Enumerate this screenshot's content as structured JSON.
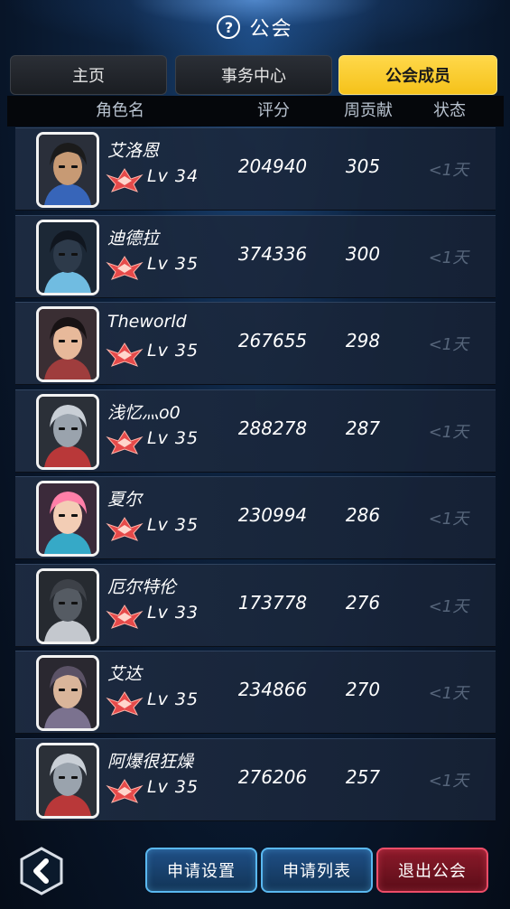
{
  "header": {
    "help_icon": "?",
    "title": "公会"
  },
  "tabs": [
    {
      "label": "主页",
      "active": false
    },
    {
      "label": "事务中心",
      "active": false
    },
    {
      "label": "公会成员",
      "active": true
    }
  ],
  "columns": {
    "name": "角色名",
    "score": "评分",
    "weekly": "周贡献",
    "status": "状态"
  },
  "members": [
    {
      "name": "艾洛恩",
      "level": "Lv 34",
      "score": "204940",
      "weekly": "305",
      "status": "<1天",
      "avatar_colors": {
        "bg": "#2a2f3a",
        "hair": "#1b1b1b",
        "skin": "#c79a74",
        "accent": "#3a6fd0"
      }
    },
    {
      "name": "迪德拉",
      "level": "Lv 35",
      "score": "374336",
      "weekly": "300",
      "status": "<1天",
      "avatar_colors": {
        "bg": "#1c2836",
        "hair": "#10161f",
        "skin": "#2d3a4a",
        "accent": "#7fd6ff"
      }
    },
    {
      "name": "Theworld",
      "level": "Lv 35",
      "score": "267655",
      "weekly": "298",
      "status": "<1天",
      "avatar_colors": {
        "bg": "#3a2e33",
        "hair": "#171214",
        "skin": "#e7b99a",
        "accent": "#b24040"
      }
    },
    {
      "name": "浅忆灬o0",
      "level": "Lv 35",
      "score": "288278",
      "weekly": "287",
      "status": "<1天",
      "avatar_colors": {
        "bg": "#2b3038",
        "hair": "#c9cfd6",
        "skin": "#9aa3ad",
        "accent": "#d23a3a"
      }
    },
    {
      "name": "夏尔",
      "level": "Lv 35",
      "score": "230994",
      "weekly": "286",
      "status": "<1天",
      "avatar_colors": {
        "bg": "#3b2a3a",
        "hair": "#ff7fa8",
        "skin": "#f3cdb5",
        "accent": "#36c0e0"
      }
    },
    {
      "name": "厄尔特伦",
      "level": "Lv 33",
      "score": "173778",
      "weekly": "276",
      "status": "<1天",
      "avatar_colors": {
        "bg": "#262a30",
        "hair": "#3d4148",
        "skin": "#555b63",
        "accent": "#e0e4ea"
      }
    },
    {
      "name": "艾达",
      "level": "Lv 35",
      "score": "234866",
      "weekly": "270",
      "status": "<1天",
      "avatar_colors": {
        "bg": "#2a2830",
        "hair": "#5b5266",
        "skin": "#d9b59a",
        "accent": "#8a7fa0"
      }
    },
    {
      "name": "阿爆很狂燥",
      "level": "Lv 35",
      "score": "276206",
      "weekly": "257",
      "status": "<1天",
      "avatar_colors": {
        "bg": "#2b3038",
        "hair": "#c9cfd6",
        "skin": "#9aa3ad",
        "accent": "#d23a3a"
      }
    }
  ],
  "footer": {
    "back_icon": "back-arrow-icon",
    "apply_settings": "申请设置",
    "apply_list": "申请列表",
    "quit_guild": "退出公会"
  },
  "colors": {
    "active_tab": "#f5c21a",
    "blue_button": "#5ab8f0",
    "red_button": "#ee4d68",
    "rank_icon": "#e64a4a"
  }
}
